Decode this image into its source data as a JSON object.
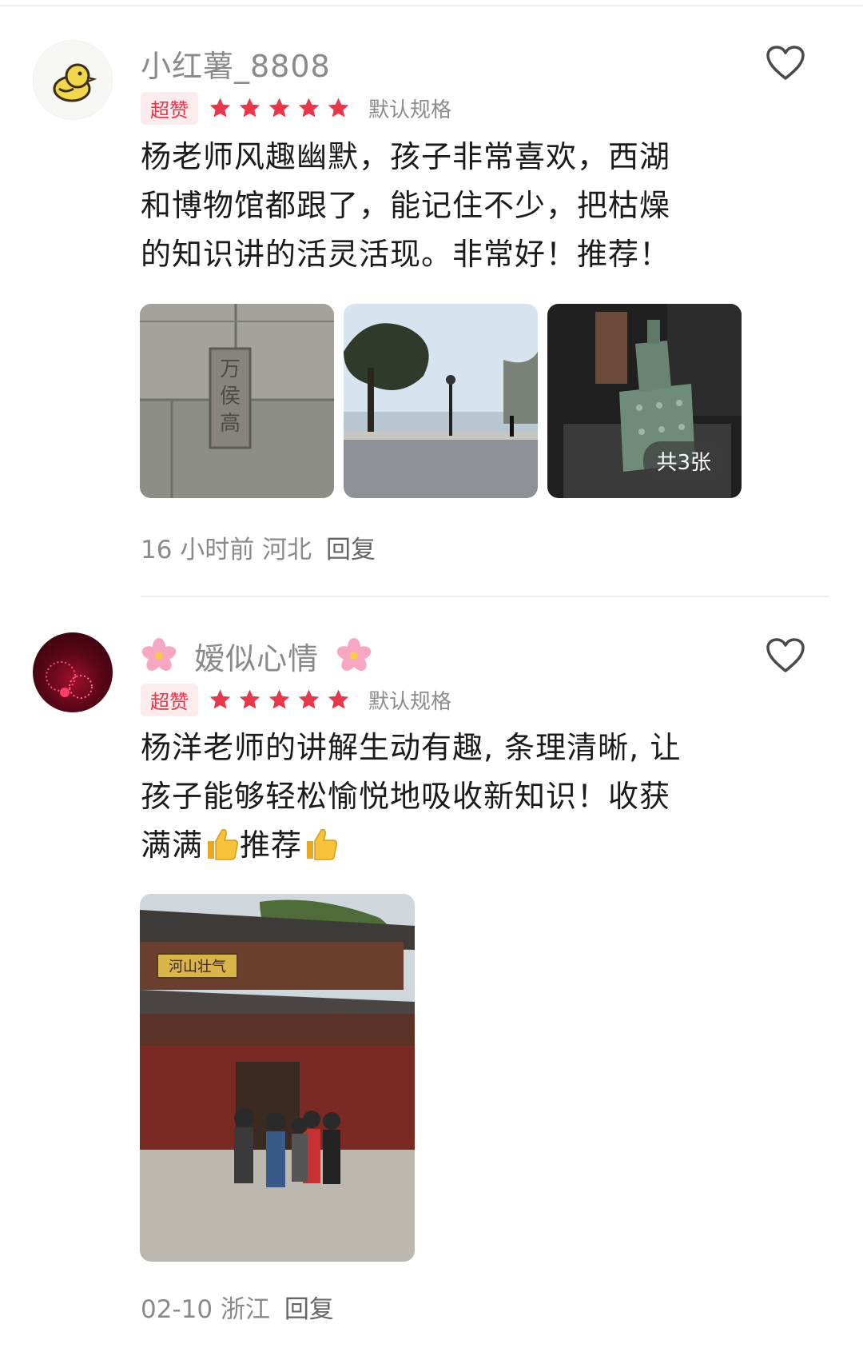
{
  "reviews": [
    {
      "username": "小红薯_8808",
      "badge": "超赞",
      "rating": 5,
      "spec": "默认规格",
      "content": "杨老师风趣幽默，孩子非常喜欢，西湖和博物馆都跟了，能记住不少，把枯燥的知识讲的活灵活现。非常好！推荐！",
      "photo_count": "共3张",
      "time": "16 小时前",
      "location": "河北",
      "reply": "回复"
    },
    {
      "username": "嫒似心情",
      "badge": "超赞",
      "rating": 5,
      "spec": "默认规格",
      "content_part1": "杨洋老师的讲解生动有趣, 条理清晰, 让孩子能够轻松愉悦地吸收新知识！收获满满",
      "content_part2": "推荐",
      "time": "02-10",
      "location": "浙江",
      "reply": "回复",
      "photo_sign": "河山壮气"
    }
  ],
  "colors": {
    "accent": "#e8364a",
    "badge_bg": "#fdecee",
    "muted": "#8a8a8a"
  },
  "icons": [
    "heart-outline-icon",
    "star-icon",
    "cherry-blossom-emoji",
    "thumbs-up-emoji"
  ]
}
